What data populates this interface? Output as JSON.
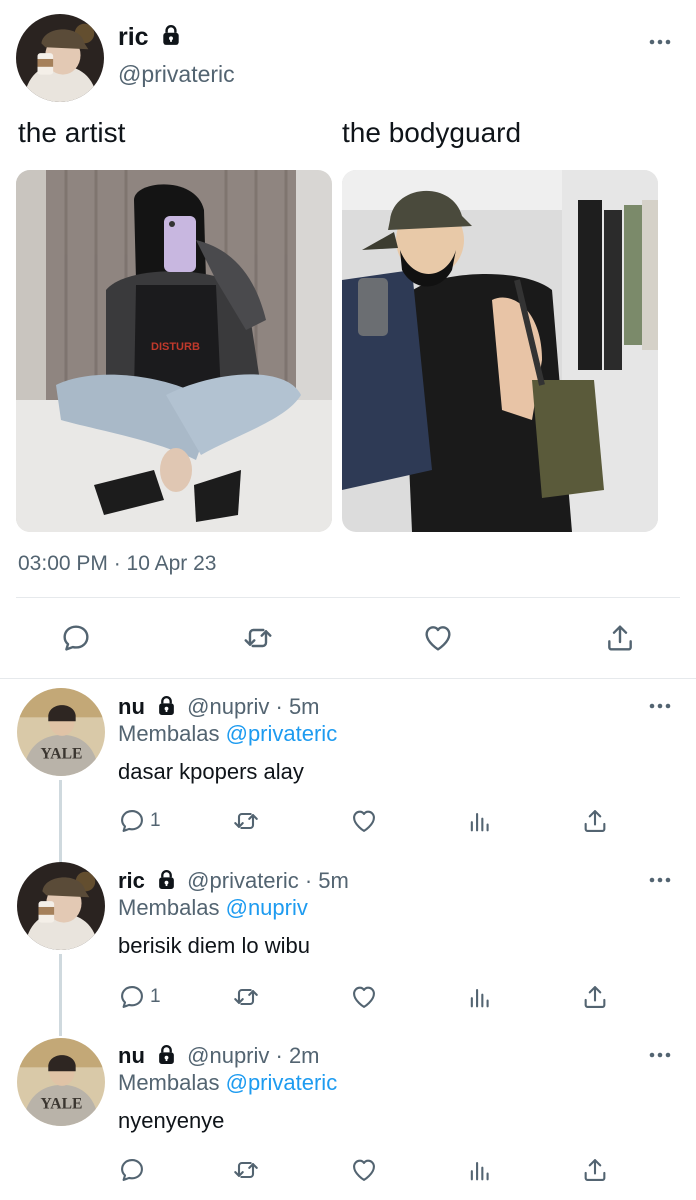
{
  "main_tweet": {
    "author": {
      "name": "ric",
      "handle": "@privateric"
    },
    "text_left": "the artist",
    "text_right": "the bodyguard",
    "timestamp": "03:00 PM · 10 Apr 23",
    "media": [
      "photo-artist",
      "photo-bodyguard"
    ],
    "actions": [
      "reply-icon",
      "retweet-icon",
      "like-icon",
      "share-icon"
    ]
  },
  "replies": [
    {
      "name": "nu",
      "handle_time": "@nupriv · 5m",
      "replying_label": "Membalas",
      "replying_to": "@privateric",
      "text": "dasar kpopers alay",
      "reply_count": "1"
    },
    {
      "name": "ric",
      "handle_time": "@privateric · 5m",
      "replying_label": "Membalas",
      "replying_to": "@nupriv",
      "text": "berisik diem lo wibu",
      "reply_count": "1"
    },
    {
      "name": "nu",
      "handle_time": "@nupriv · 2m",
      "replying_label": "Membalas",
      "replying_to": "@privateric",
      "text": "nyenyenye",
      "reply_count": ""
    }
  ],
  "colors": {
    "accent": "#1d9bf0",
    "muted": "#536471",
    "text": "#0f1419",
    "divider": "#e6e9ec"
  }
}
